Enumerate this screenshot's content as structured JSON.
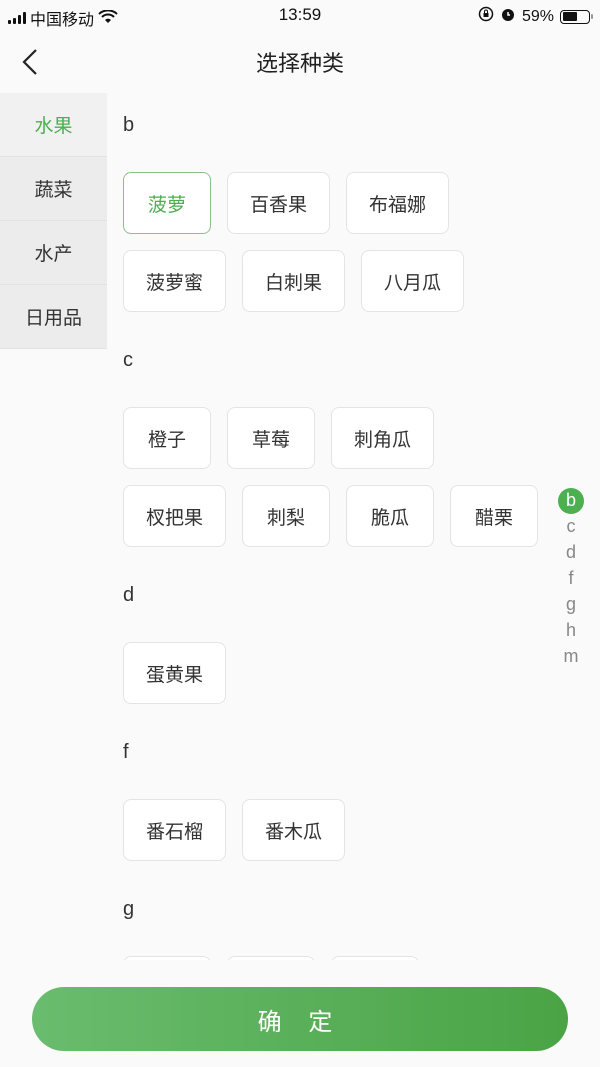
{
  "status_bar": {
    "carrier": "中国移动",
    "time": "13:59",
    "battery": "59%",
    "battery_level": 0.59
  },
  "header": {
    "title": "选择种类"
  },
  "sidebar": {
    "items": [
      {
        "label": "水果",
        "active": true
      },
      {
        "label": "蔬菜",
        "active": false
      },
      {
        "label": "水产",
        "active": false
      },
      {
        "label": "日用品",
        "active": false
      }
    ]
  },
  "sections": [
    {
      "letter": "b",
      "items": [
        "菠萝",
        "百香果",
        "布福娜",
        "菠萝蜜",
        "白刺果",
        "八月瓜"
      ],
      "selected": "菠萝"
    },
    {
      "letter": "c",
      "items": [
        "橙子",
        "草莓",
        "刺角瓜",
        "杈把果",
        "刺梨",
        "脆瓜",
        "醋栗"
      ]
    },
    {
      "letter": "d",
      "items": [
        "蛋黄果"
      ]
    },
    {
      "letter": "f",
      "items": [
        "番石榴",
        "番木瓜"
      ]
    },
    {
      "letter": "g",
      "items": []
    }
  ],
  "index_bar": {
    "letters": [
      "b",
      "c",
      "d",
      "f",
      "g",
      "h",
      "m"
    ],
    "active": "b"
  },
  "footer": {
    "confirm_label": "确 定"
  },
  "colors": {
    "accent": "#4caf50"
  }
}
